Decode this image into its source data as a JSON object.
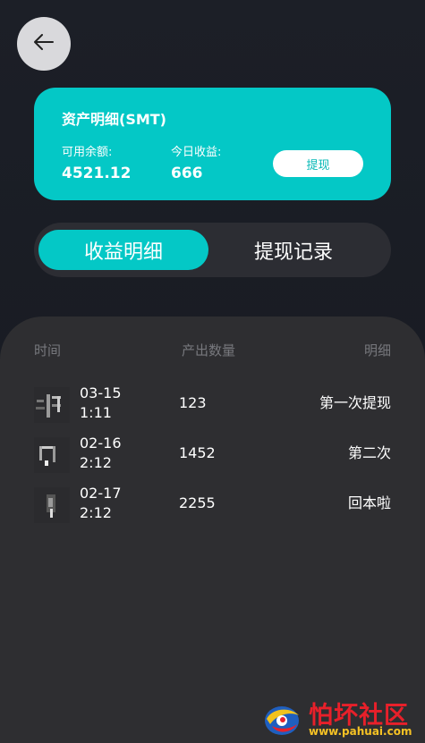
{
  "asset": {
    "title": "资产明细(SMT)",
    "available_label": "可用余额:",
    "available_value": "4521.12",
    "today_label": "今日收益:",
    "today_value": "666",
    "withdraw_label": "提现"
  },
  "tabs": [
    {
      "label": "收益明细",
      "active": true
    },
    {
      "label": "提现记录",
      "active": false
    }
  ],
  "records": {
    "headers": {
      "time": "时间",
      "output": "产出数量",
      "detail": "明细"
    },
    "rows": [
      {
        "date": "03-15",
        "time": "1:11",
        "amount": "123",
        "note": "第一次提现"
      },
      {
        "date": "02-16",
        "time": "2:12",
        "amount": "1452",
        "note": "第二次"
      },
      {
        "date": "02-17",
        "time": "2:12",
        "amount": "2255",
        "note": "回本啦"
      }
    ]
  },
  "watermark": {
    "title": "怕坏社区",
    "url": "www.pahuai.com"
  },
  "colors": {
    "accent": "#04c8c6",
    "background": "#1b1d24",
    "panel": "#2e2e31",
    "tab_track": "#2c2d33"
  },
  "icons": {
    "back": "arrow-left-icon"
  }
}
